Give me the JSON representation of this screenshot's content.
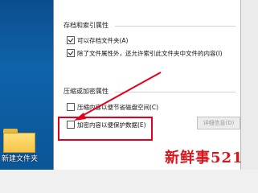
{
  "desktop": {
    "folder_label": "新建文件夹"
  },
  "dialog": {
    "top_label": "",
    "archive_group": {
      "title": "存档和索引属性",
      "option1": "可以存档文件夹(A)",
      "option2": "除了文件属性外，还允许索引此文件夹中文件的内容(I)"
    },
    "compress_group": {
      "title": "压缩或加密属性",
      "option1": "压缩内容以便节省磁盘空间(C)",
      "option2": "加密内容以便保护数据(E)",
      "details_button": "详细信息(D)"
    }
  },
  "overlay": {
    "watermark": "新鲜事521",
    "accent_color": "#e4001b"
  }
}
